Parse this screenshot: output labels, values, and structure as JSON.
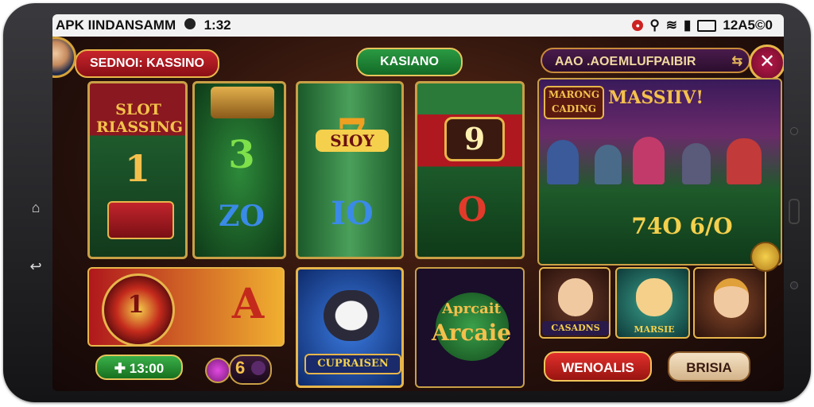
{
  "statusbar": {
    "app_name": "APK IINDANSAMM",
    "time": "1:32",
    "battery_text": "12A5©0"
  },
  "header": {
    "title": "SEDNOI: KASSINO",
    "center_tab": "KASIANO",
    "mode_label_1": "AAO .AOE",
    "mode_label_2": "MLUFPAIBIR"
  },
  "reels": {
    "reel1_banner": "SLOT RIASSING",
    "reel1_symbol": "1",
    "reel2_symbol_top": "3",
    "reel2_symbol_bottom": "ZO",
    "reel3_symbol_top": "SIOY",
    "reel3_symbol_bottom": "IO",
    "reel4_symbol_top": "9",
    "reel4_symbol_bottom": "O"
  },
  "promo": {
    "badge": "MARONG CADING",
    "headline": "MASSIIV!",
    "table_numbers": "74O 6/O"
  },
  "bottom_tiles": {
    "roulette_number": "1",
    "letter_tile": "A",
    "cat_banner": "CUPRAISEN",
    "arcade_title": "Arcaie",
    "arcade_pre": "Aprcait",
    "mini1_label": "CASADNS",
    "mini2_label": "MARSIE"
  },
  "controls": {
    "balance_button": "13:00",
    "chip_value": "6",
    "win_button": "WENOALIS",
    "secondary_button": "BRISIA"
  },
  "colors": {
    "accent_red": "#c8242c",
    "accent_green": "#2a9a43",
    "gold_border": "#c9a046"
  }
}
